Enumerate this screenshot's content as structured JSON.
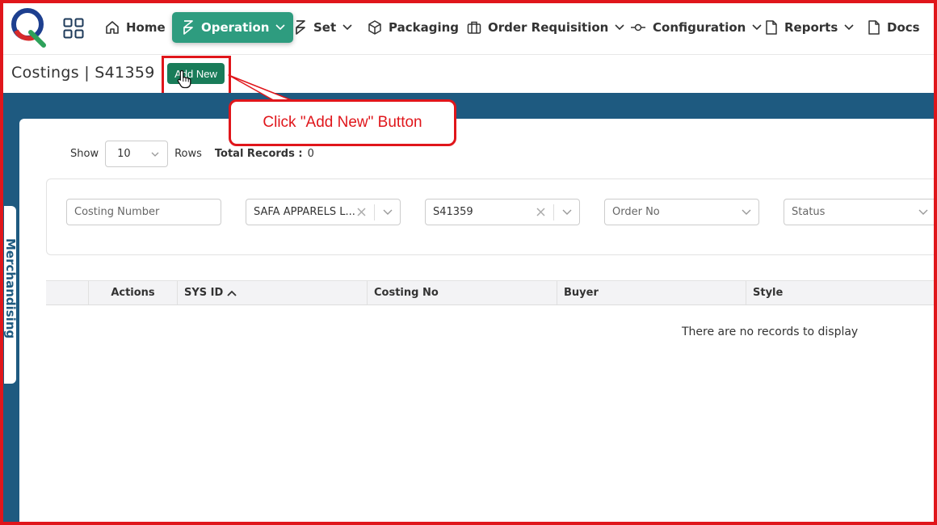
{
  "nav": {
    "items": [
      {
        "label": "Home",
        "icon": "home-icon"
      },
      {
        "label": "Operation",
        "icon": "operation-icon",
        "active": true
      },
      {
        "label": "Set",
        "icon": "set-icon"
      },
      {
        "label": "Packaging",
        "icon": "package-icon"
      },
      {
        "label": "Order Requisition",
        "icon": "briefcase-icon"
      },
      {
        "label": "Configuration",
        "icon": "commit-icon"
      },
      {
        "label": "Reports",
        "icon": "document-icon"
      },
      {
        "label": "Docs",
        "icon": "document-icon"
      }
    ],
    "active_color": "#2e9c7f"
  },
  "header": {
    "title": "Costings | S41359 |",
    "add_button": "Add New"
  },
  "callout": {
    "text": "Click \"Add New\" Button",
    "color": "#e0161b"
  },
  "sidebar_tab": "Merchandising",
  "toolbar": {
    "show_label": "Show",
    "rows_value": "10",
    "rows_label": "Rows",
    "total_label": "Total Records :",
    "total_value": "0"
  },
  "filters": {
    "costing_number_placeholder": "Costing Number",
    "buyer_value": "SAFA APPARELS L...",
    "style_value": "S41359",
    "order_placeholder": "Order No",
    "status_placeholder": "Status"
  },
  "table": {
    "columns": [
      "",
      "Actions",
      "SYS ID",
      "Costing No",
      "Buyer",
      "Style"
    ],
    "empty_text": "There are no records to display"
  },
  "colors": {
    "band": "#1e5a80",
    "button": "#197c59",
    "highlight": "#e0161b"
  }
}
